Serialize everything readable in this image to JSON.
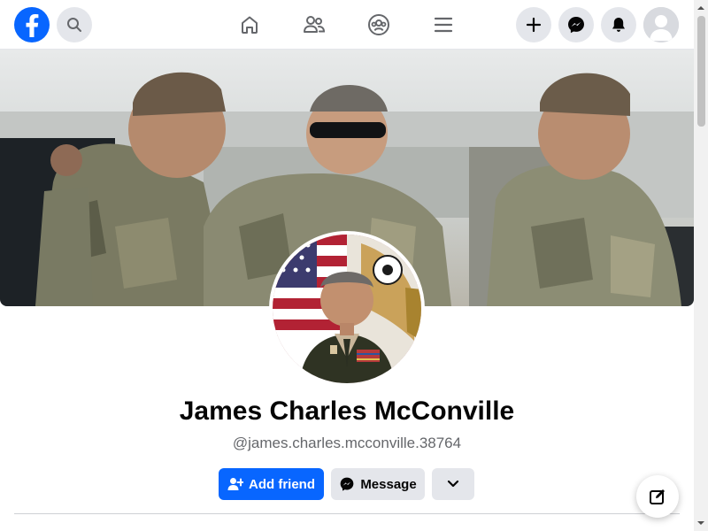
{
  "topbar": {
    "logo_icon": "facebook-logo-icon",
    "search_icon": "search-icon",
    "nav": [
      "home-icon",
      "friends-icon",
      "groups-icon",
      "menu-icon"
    ],
    "actions": [
      "create-icon",
      "messenger-icon",
      "notifications-icon"
    ],
    "account_icon": "account-avatar-icon"
  },
  "profile": {
    "name": "James Charles McConville",
    "handle": "@james.charles.mcconville.38764"
  },
  "buttons": {
    "add_friend": "Add friend",
    "message": "Message"
  },
  "colors": {
    "brand": "#0866ff",
    "button_gray": "#e4e6eb",
    "text_primary": "#050505",
    "text_secondary": "#65676b"
  }
}
